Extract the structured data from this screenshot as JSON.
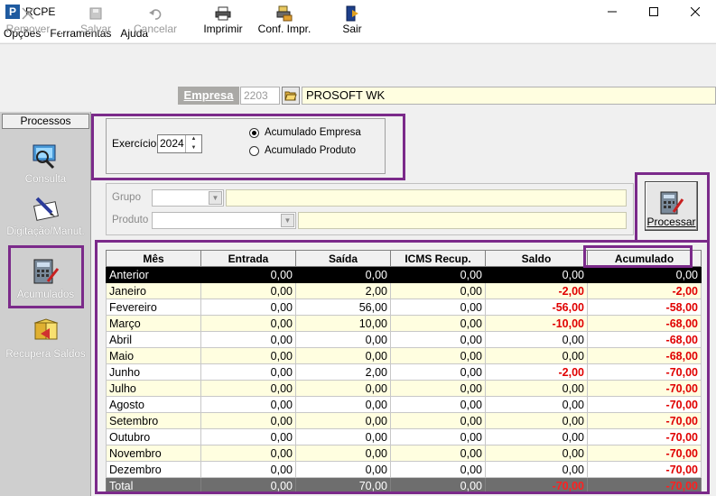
{
  "window": {
    "title": "RCPE",
    "app_icon": "P",
    "controls": [
      "minimize-icon",
      "maximize-icon",
      "close-icon"
    ]
  },
  "menu": [
    "Opções",
    "Ferramentas",
    "Ajuda"
  ],
  "toolbar": {
    "remover": "Remover",
    "salvar": "Salvar",
    "cancelar": "Cancelar",
    "imprimir": "Imprimir",
    "conf_impr": "Conf. Impr.",
    "sair": "Sair"
  },
  "empresa": {
    "label": "Empresa",
    "code": "2203",
    "name": "PROSOFT WK"
  },
  "sidebar": {
    "title": "Processos",
    "items": [
      {
        "label": "Consulta",
        "icon": "consulta-icon"
      },
      {
        "label": "Digitação/Manut.",
        "icon": "digitacao-icon"
      },
      {
        "label": "Acumulados",
        "icon": "acumulados-icon",
        "selected": true
      },
      {
        "label": "Recupera Saldos",
        "icon": "recupera-saldos-icon"
      }
    ]
  },
  "form": {
    "exercicio_label": "Exercício",
    "exercicio_value": "2024",
    "radio_empresa": "Acumulado  Empresa",
    "radio_produto": "Acumulado Produto",
    "selected_mode": "empresa",
    "grupo_label": "Grupo",
    "produto_label": "Produto",
    "processar_label": "Processar"
  },
  "grid": {
    "columns": [
      "Mês",
      "Entrada",
      "Saída",
      "ICMS Recup.",
      "Saldo",
      "Acumulado"
    ],
    "rows": [
      [
        "Anterior",
        "0,00",
        "0,00",
        "0,00",
        "0,00",
        "0,00"
      ],
      [
        "Janeiro",
        "0,00",
        "2,00",
        "0,00",
        "-2,00",
        "-2,00"
      ],
      [
        "Fevereiro",
        "0,00",
        "56,00",
        "0,00",
        "-56,00",
        "-58,00"
      ],
      [
        "Março",
        "0,00",
        "10,00",
        "0,00",
        "-10,00",
        "-68,00"
      ],
      [
        "Abril",
        "0,00",
        "0,00",
        "0,00",
        "0,00",
        "-68,00"
      ],
      [
        "Maio",
        "0,00",
        "0,00",
        "0,00",
        "0,00",
        "-68,00"
      ],
      [
        "Junho",
        "0,00",
        "2,00",
        "0,00",
        "-2,00",
        "-70,00"
      ],
      [
        "Julho",
        "0,00",
        "0,00",
        "0,00",
        "0,00",
        "-70,00"
      ],
      [
        "Agosto",
        "0,00",
        "0,00",
        "0,00",
        "0,00",
        "-70,00"
      ],
      [
        "Setembro",
        "0,00",
        "0,00",
        "0,00",
        "0,00",
        "-70,00"
      ],
      [
        "Outubro",
        "0,00",
        "0,00",
        "0,00",
        "0,00",
        "-70,00"
      ],
      [
        "Novembro",
        "0,00",
        "0,00",
        "0,00",
        "0,00",
        "-70,00"
      ],
      [
        "Dezembro",
        "0,00",
        "0,00",
        "0,00",
        "0,00",
        "-70,00"
      ]
    ],
    "total": [
      "Total",
      "0,00",
      "70,00",
      "0,00",
      "-70,00",
      "-70,00"
    ]
  },
  "colors": {
    "highlight": "#7b2a8a",
    "negative": "#e00000",
    "row_alt": "#fffee0",
    "selected_row": "#000000",
    "total_row": "#6e6e6e"
  }
}
